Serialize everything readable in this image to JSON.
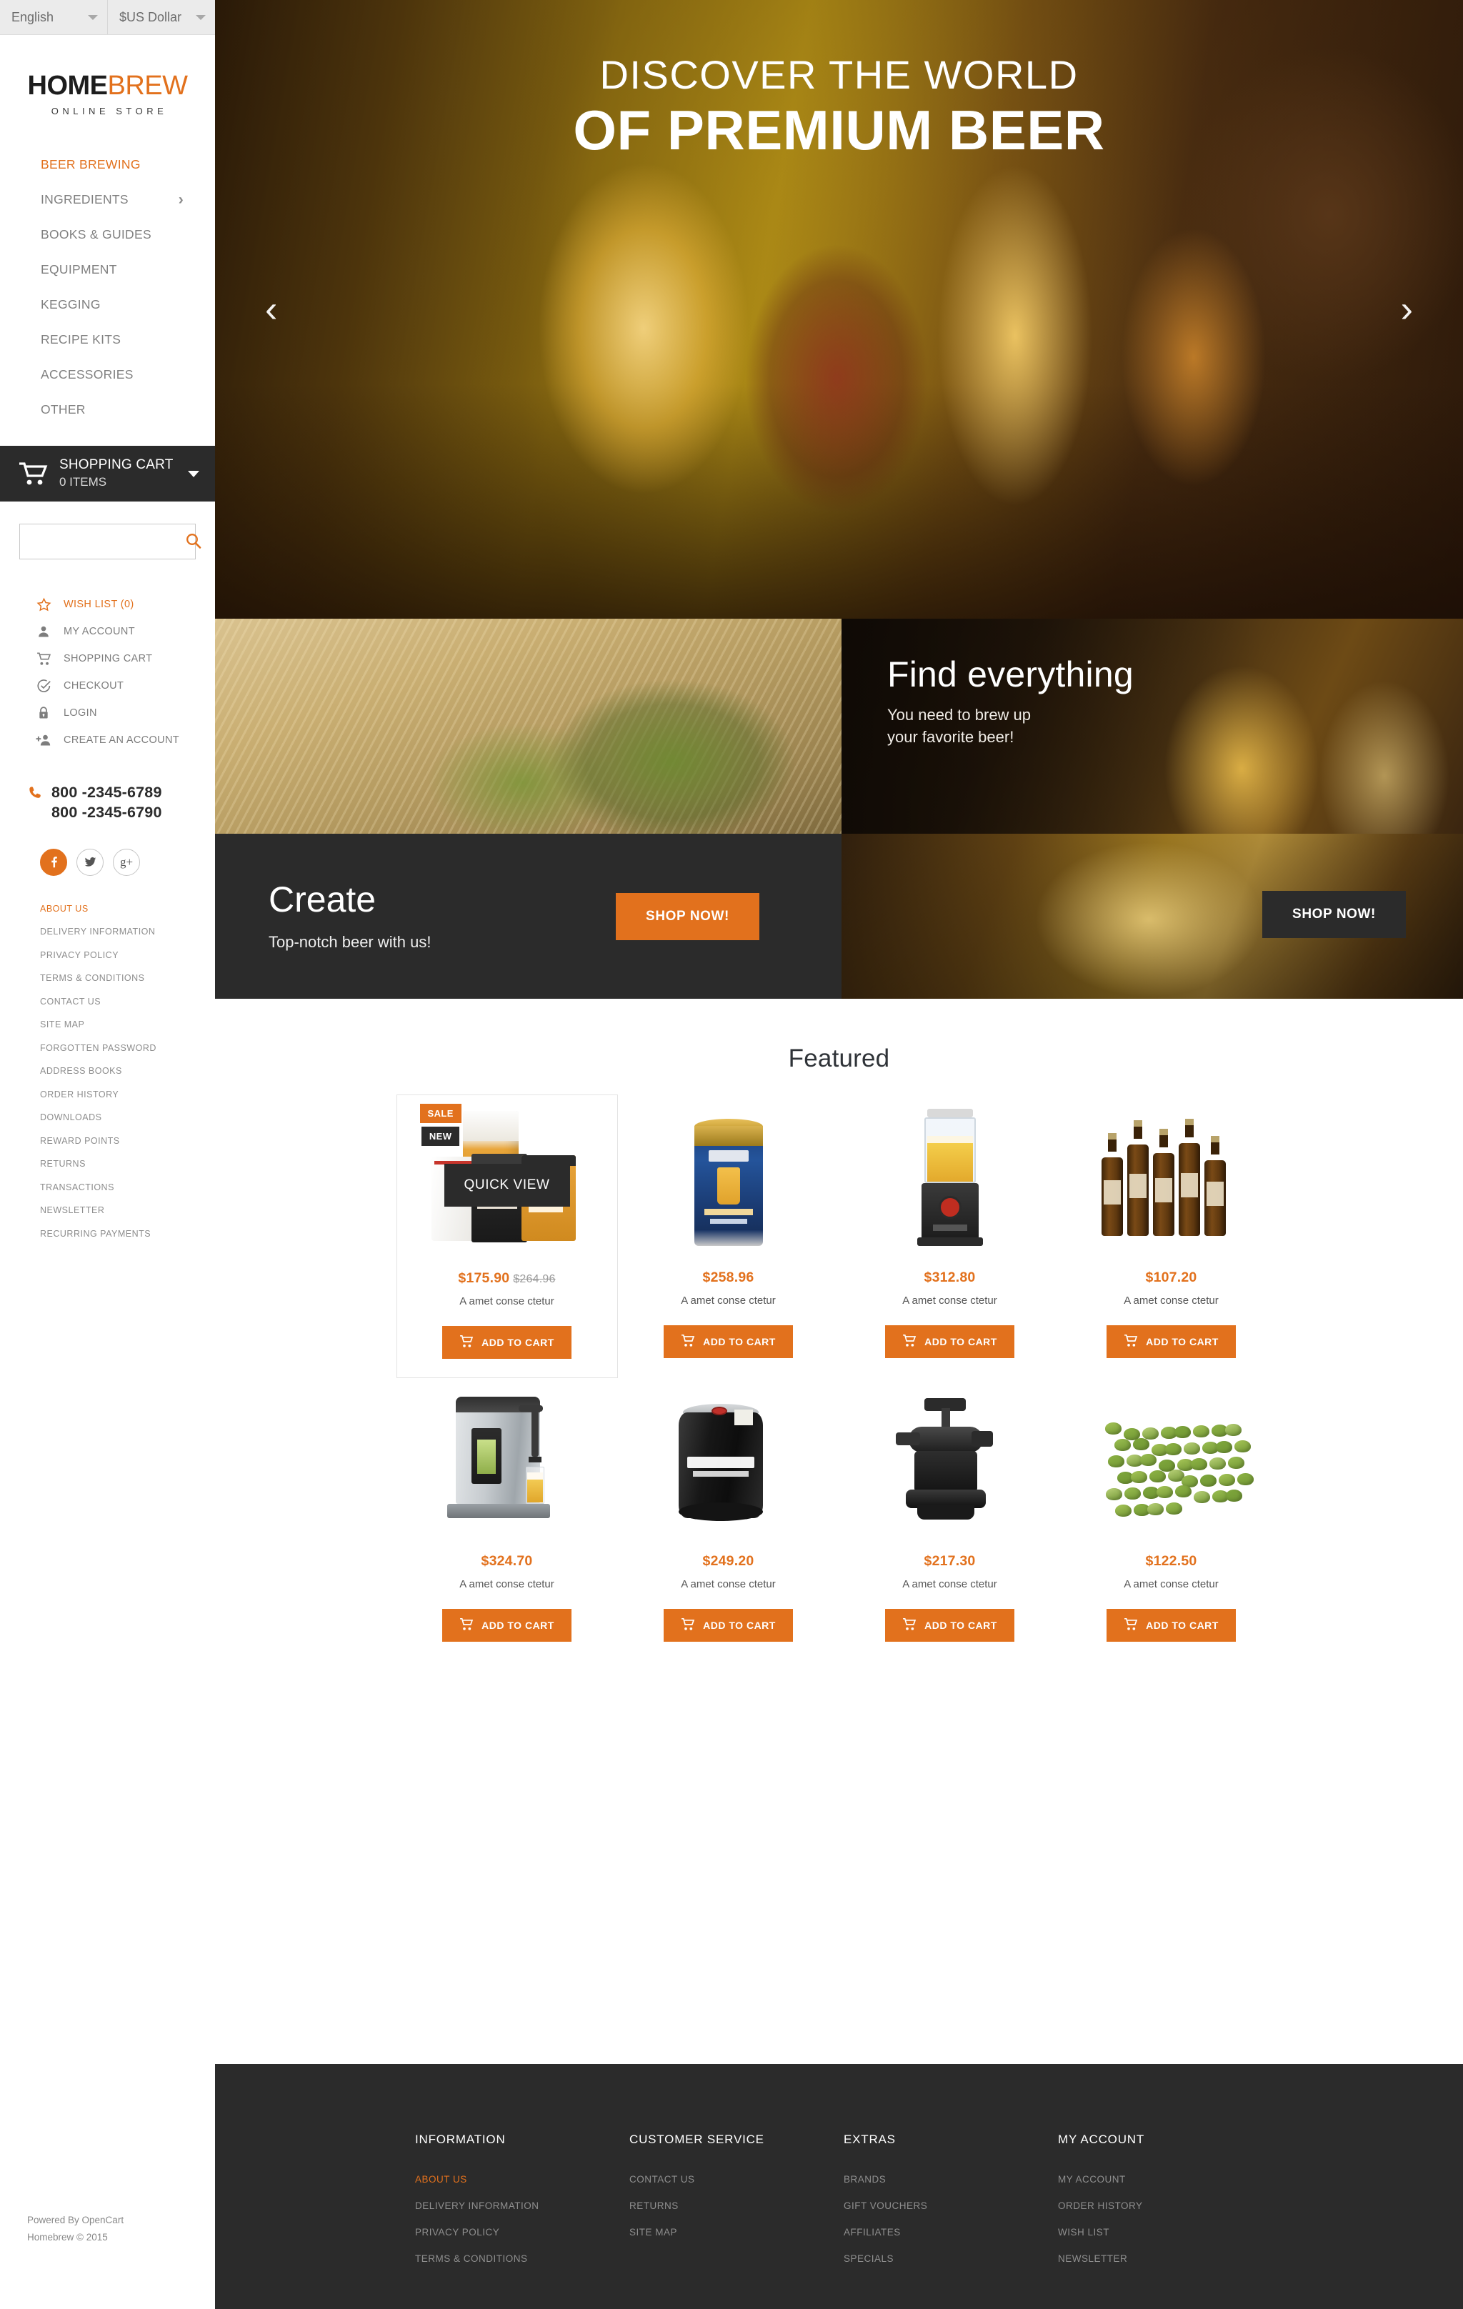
{
  "topbar": {
    "language": "English",
    "currency": "$US Dollar"
  },
  "logo": {
    "part1": "HOME",
    "part2": "BREW",
    "tagline": "ONLINE STORE"
  },
  "nav": [
    {
      "label": "BEER BREWING",
      "active": true,
      "arrow": false
    },
    {
      "label": "INGREDIENTS",
      "active": false,
      "arrow": true
    },
    {
      "label": "BOOKS & GUIDES",
      "active": false,
      "arrow": false
    },
    {
      "label": "EQUIPMENT",
      "active": false,
      "arrow": false
    },
    {
      "label": "KEGGING",
      "active": false,
      "arrow": false
    },
    {
      "label": "RECIPE KITS",
      "active": false,
      "arrow": false
    },
    {
      "label": "ACCESSORIES",
      "active": false,
      "arrow": false
    },
    {
      "label": "OTHER",
      "active": false,
      "arrow": false
    }
  ],
  "cart": {
    "title": "SHOPPING CART",
    "count": "0 ITEMS"
  },
  "search": {
    "value": "",
    "placeholder": ""
  },
  "account_links": [
    {
      "label": "WISH LIST (0)",
      "icon": "star-icon",
      "highlight": true
    },
    {
      "label": "MY ACCOUNT",
      "icon": "user-icon",
      "highlight": false
    },
    {
      "label": "SHOPPING CART",
      "icon": "cart-icon",
      "highlight": false
    },
    {
      "label": "CHECKOUT",
      "icon": "check-circle-icon",
      "highlight": false
    },
    {
      "label": "LOGIN",
      "icon": "lock-icon",
      "highlight": false
    },
    {
      "label": "CREATE AN ACCOUNT",
      "icon": "user-plus-icon",
      "highlight": false
    }
  ],
  "phones": [
    "800 -2345-6789",
    "800 -2345-6790"
  ],
  "social": [
    {
      "name": "facebook",
      "glyph": "f"
    },
    {
      "name": "twitter",
      "glyph": "t"
    },
    {
      "name": "google-plus",
      "glyph": "g+"
    }
  ],
  "sidebar_footer_links": [
    {
      "label": "ABOUT US",
      "highlight": true
    },
    {
      "label": "DELIVERY INFORMATION",
      "highlight": false
    },
    {
      "label": "PRIVACY POLICY",
      "highlight": false
    },
    {
      "label": "TERMS & CONDITIONS",
      "highlight": false
    },
    {
      "label": "CONTACT US",
      "highlight": false
    },
    {
      "label": "SITE MAP",
      "highlight": false
    },
    {
      "label": "FORGOTTEN PASSWORD",
      "highlight": false
    },
    {
      "label": "ADDRESS BOOKS",
      "highlight": false
    },
    {
      "label": "ORDER HISTORY",
      "highlight": false
    },
    {
      "label": "DOWNLOADS",
      "highlight": false
    },
    {
      "label": "REWARD POINTS",
      "highlight": false
    },
    {
      "label": "RETURNS",
      "highlight": false
    },
    {
      "label": "TRANSACTIONS",
      "highlight": false
    },
    {
      "label": "NEWSLETTER",
      "highlight": false
    },
    {
      "label": "RECURRING PAYMENTS",
      "highlight": false
    }
  ],
  "copyright": {
    "line1": "Powered By OpenCart",
    "line2": "Homebrew © 2015"
  },
  "hero": {
    "line1": "DISCOVER THE WORLD",
    "line2": "OF PREMIUM BEER",
    "prev": "‹",
    "next": "›"
  },
  "promo_right": {
    "heading": "Find everything",
    "line1": "You need to brew up",
    "line2": "your favorite beer!",
    "button": "SHOP NOW!"
  },
  "promo_create": {
    "heading": "Create",
    "sub": "Top-notch beer with us!",
    "button": "SHOP NOW!"
  },
  "featured": {
    "title": "Featured",
    "quick_view": "QUICK VIEW",
    "badge_sale": "SALE",
    "badge_new": "NEW",
    "add_to_cart": "ADD TO CART",
    "products": [
      {
        "price": "$175.90",
        "old_price": "$264.96",
        "desc": "A amet conse ctetur",
        "art": "kit"
      },
      {
        "price": "$258.96",
        "old_price": "",
        "desc": "A amet conse ctetur",
        "art": "aztec"
      },
      {
        "price": "$312.80",
        "old_price": "",
        "desc": "A amet conse ctetur",
        "art": "dispenser"
      },
      {
        "price": "$107.20",
        "old_price": "",
        "desc": "A amet conse ctetur",
        "art": "bottles"
      },
      {
        "price": "$324.70",
        "old_price": "",
        "desc": "A amet conse ctetur",
        "art": "kegerator"
      },
      {
        "price": "$249.20",
        "old_price": "",
        "desc": "A amet conse ctetur",
        "art": "keg"
      },
      {
        "price": "$217.30",
        "old_price": "",
        "desc": "A amet conse ctetur",
        "art": "coupler"
      },
      {
        "price": "$122.50",
        "old_price": "",
        "desc": "A amet conse ctetur",
        "art": "hops"
      }
    ]
  },
  "footer": {
    "columns": [
      {
        "heading": "INFORMATION",
        "items": [
          {
            "label": "ABOUT US",
            "highlight": true
          },
          {
            "label": "DELIVERY INFORMATION",
            "highlight": false
          },
          {
            "label": "PRIVACY POLICY",
            "highlight": false
          },
          {
            "label": "TERMS & CONDITIONS",
            "highlight": false
          }
        ]
      },
      {
        "heading": "CUSTOMER SERVICE",
        "items": [
          {
            "label": "CONTACT US",
            "highlight": false
          },
          {
            "label": "RETURNS",
            "highlight": false
          },
          {
            "label": "SITE MAP",
            "highlight": false
          }
        ]
      },
      {
        "heading": "EXTRAS",
        "items": [
          {
            "label": "BRANDS",
            "highlight": false
          },
          {
            "label": "GIFT VOUCHERS",
            "highlight": false
          },
          {
            "label": "AFFILIATES",
            "highlight": false
          },
          {
            "label": "SPECIALS",
            "highlight": false
          }
        ]
      },
      {
        "heading": "MY ACCOUNT",
        "items": [
          {
            "label": "MY ACCOUNT",
            "highlight": false
          },
          {
            "label": "ORDER HISTORY",
            "highlight": false
          },
          {
            "label": "WISH LIST",
            "highlight": false
          },
          {
            "label": "NEWSLETTER",
            "highlight": false
          }
        ]
      }
    ]
  },
  "colors": {
    "accent": "#e2711d",
    "dark": "#2b2b2b",
    "muted": "#8f8f8f"
  }
}
